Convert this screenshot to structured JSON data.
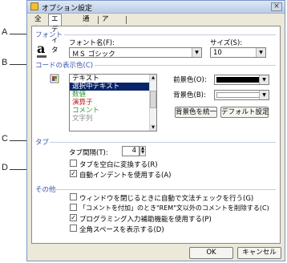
{
  "callouts": [
    "A",
    "B",
    "C",
    "D"
  ],
  "window": {
    "title": "オプション設定",
    "close_label": "×"
  },
  "tabs": [
    {
      "label": "全般",
      "active": false
    },
    {
      "label": "エディタ",
      "active": true
    },
    {
      "label": "通信",
      "active": false
    },
    {
      "label": "アーム",
      "active": false
    }
  ],
  "sections": {
    "font": "フォント",
    "colors": "コードの表示色(C)",
    "tab": "タブ",
    "other": "その他"
  },
  "font": {
    "name_label": "フォント名(F):",
    "name_value": "ＭＳ ゴシック",
    "size_label": "サイズ(S):",
    "size_value": "10",
    "preview_glyph": "a"
  },
  "colors": {
    "items": [
      {
        "label": "テキスト",
        "color": "#000000"
      },
      {
        "label": "選択中テキスト",
        "color": "#ffffff",
        "selected": true
      },
      {
        "label": "数値",
        "color": "#2e9a2e"
      },
      {
        "label": "演算子",
        "color": "#c01818"
      },
      {
        "label": "コメント",
        "color": "#2e9a2e"
      },
      {
        "label": "文字列",
        "color": "#888888"
      }
    ],
    "fg_label": "前景色(O):",
    "fg_color": "#000000",
    "bg_label": "背景色(B):",
    "bg_color": "#ffffff",
    "unify_button": "背景色を統一",
    "default_button": "デフォルト設定"
  },
  "tab": {
    "width_label": "タブ間隔(T):",
    "width_value": "4",
    "options": [
      {
        "label": "タブを空白に変換する(R)",
        "checked": false
      },
      {
        "label": "自動インデントを使用する(A)",
        "checked": true
      }
    ]
  },
  "other": {
    "options": [
      {
        "label": "ウィンドウを閉じるときに自動で文法チェックを行う(G)",
        "checked": false
      },
      {
        "label": "「コメントを付加」のとき\"REM\"文以外のコメントを削除する(C)",
        "checked": false
      },
      {
        "label": "プログラミング入力補助機能を使用する(P)",
        "checked": true
      },
      {
        "label": "全角スペースを表示する(D)",
        "checked": false
      }
    ]
  },
  "footer": {
    "ok": "OK",
    "cancel": "キャンセル"
  }
}
